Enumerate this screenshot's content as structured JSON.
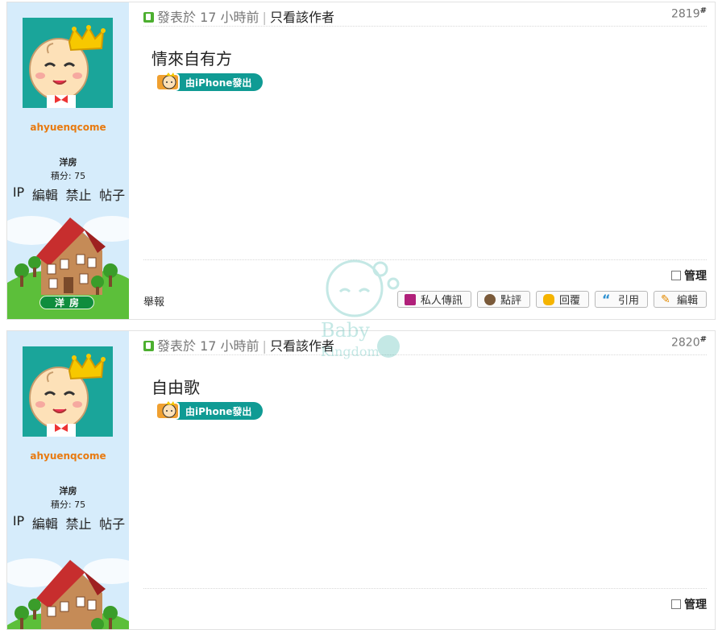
{
  "posts": [
    {
      "username": "ahyuenqcome",
      "rank": "洋房",
      "score": "積分: 75",
      "tools": [
        "IP",
        "編輯",
        "禁止",
        "帖子"
      ],
      "rank_badge": "洋房",
      "posted": "發表於 17 小時前",
      "only_author": "只看該作者",
      "floor": "2819",
      "floor_mark": "#",
      "content": "情來自有方",
      "iphone_label": "由iPhone發出",
      "manage": "管理",
      "report": "舉報",
      "buttons": [
        "私人傳訊",
        "點評",
        "回覆",
        "引用",
        "編輯"
      ]
    },
    {
      "username": "ahyuenqcome",
      "rank": "洋房",
      "score": "積分: 75",
      "tools": [
        "IP",
        "編輯",
        "禁止",
        "帖子"
      ],
      "posted": "發表於 17 小時前",
      "only_author": "只看該作者",
      "floor": "2820",
      "floor_mark": "#",
      "content": "自由歌",
      "iphone_label": "由iPhone發出",
      "manage": "管理"
    }
  ],
  "watermark": {
    "line1": "Baby",
    "line2": "Kingdom"
  },
  "colors": {
    "avatar_bg": "#1aa59a",
    "username": "#e87a10",
    "iphone_pill": "#109b94",
    "rank_badge": "#0f8d3d",
    "side_bg": "#d6ecfb"
  }
}
